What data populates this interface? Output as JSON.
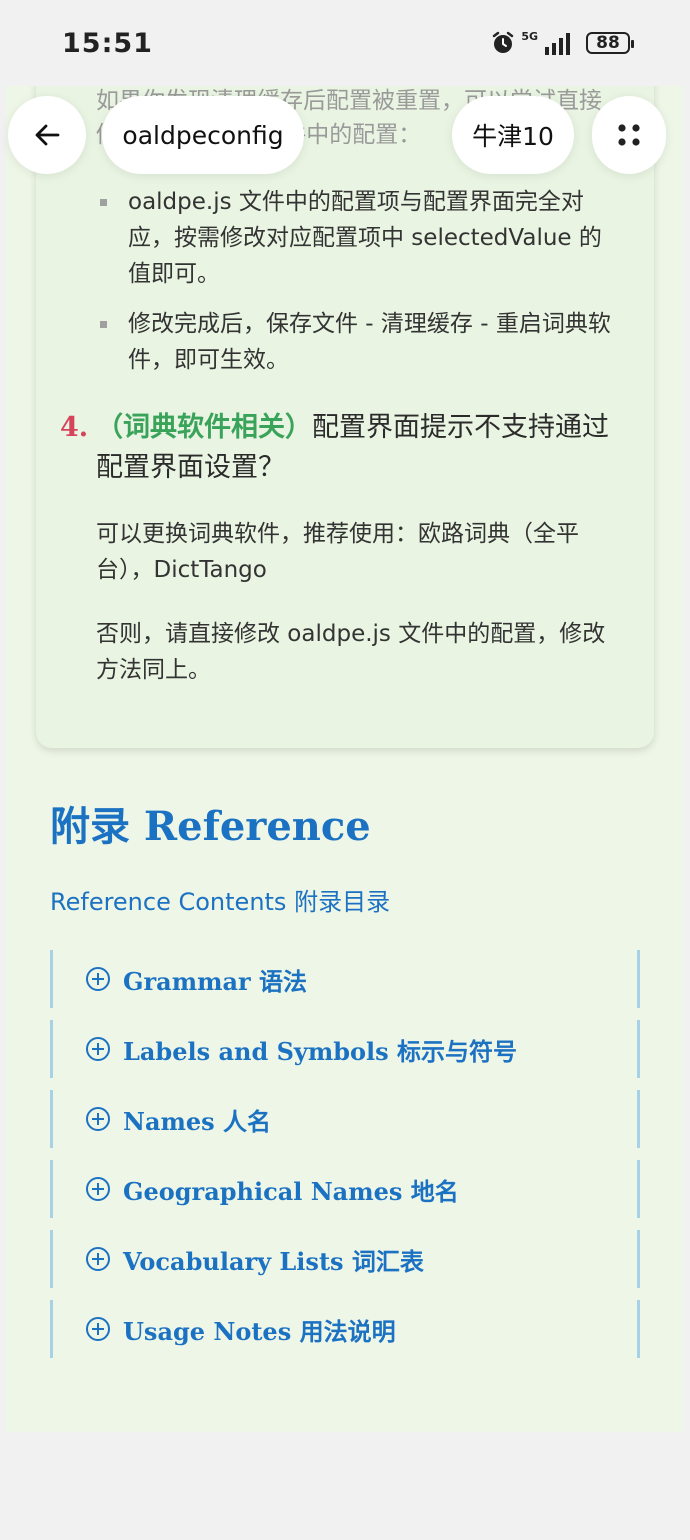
{
  "status": {
    "time": "15:51",
    "network": "5G",
    "battery": "88"
  },
  "topbar": {
    "page_title": "oaldpeconfig",
    "dict_name": "牛津10"
  },
  "content": {
    "faded_paragraph": "如果你发现清理缓存后配置被重置，可以尝试直接修改 oaldpe.js 文件中的配置：",
    "bullets": [
      "oaldpe.js 文件中的配置项与配置界面完全对应，按需修改对应配置项中 selectedValue 的值即可。",
      "修改完成后，保存文件 - 清理缓存 - 重启词典软件，即可生效。"
    ],
    "q4": {
      "number": "4.",
      "tag": "（词典软件相关）",
      "question": "配置界面提示不支持通过配置界面设置？"
    },
    "answer1": "可以更换词典软件，推荐使用：欧路词典（全平台），DictTango",
    "answer2": "否则，请直接修改 oaldpe.js 文件中的配置，修改方法同上。"
  },
  "reference": {
    "title": "附录 Reference",
    "subtitle": "Reference Contents 附录目录",
    "items": [
      "Grammar 语法",
      "Labels and Symbols 标示与符号",
      "Names 人名",
      "Geographical Names 地名",
      "Vocabulary Lists 词汇表",
      "Usage Notes 用法说明"
    ]
  },
  "icons": {
    "back": "arrow-left-icon",
    "menu": "grid-dots-icon",
    "expand": "circle-plus-icon",
    "alarm": "alarm-clock-icon",
    "signal": "signal-bars-icon"
  },
  "colors": {
    "accent_blue": "#1c72c2",
    "question_number": "#d5445a",
    "question_tag": "#3aa35a",
    "card_bg": "#e9f4e2"
  }
}
